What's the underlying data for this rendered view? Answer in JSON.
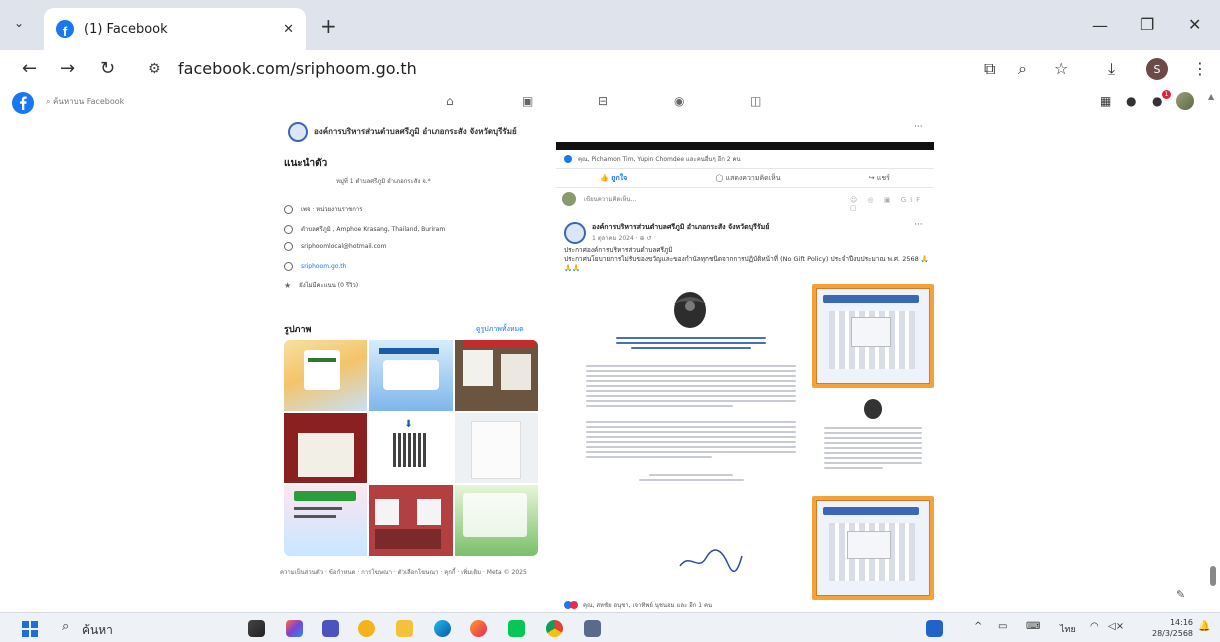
{
  "browser": {
    "tab_title": "(1) Facebook",
    "tab_close": "✕",
    "new_tab": "+",
    "url": "facebook.com/sriphoom.go.th",
    "profile_initial": "S",
    "window_minimize": "—",
    "window_restore": "❐",
    "window_close": "✕"
  },
  "fb": {
    "search_placeholder": "ค้นหาบน Facebook",
    "notification_count": "1"
  },
  "page": {
    "name": "องค์การบริหารส่วนตำบลศรีภูมิ อำเภอกระสัง จังหวัดบุรีรัมย์",
    "intro_title": "แนะนำตัว",
    "intro_desc": "หมู่ที่ 1 ตำบลศรีภูมิ อำเภอกระสัง จ.*",
    "info": [
      {
        "icon": "info-icon",
        "text": "เพจ · หน่วยงานราชการ"
      },
      {
        "icon": "location-icon",
        "text": "ตำบลศรีภูมิ , Amphoe Krasang, Thailand, Buriram"
      },
      {
        "icon": "email-icon",
        "text": "sriphoomlocal@hotmail.com"
      },
      {
        "icon": "globe-icon",
        "text": "sriphoom.go.th"
      },
      {
        "icon": "star-icon",
        "text": "ยังไม่มีคะแนน (0 รีวิว)"
      }
    ],
    "photos_title": "รูปภาพ",
    "photos_link": "ดูรูปภาพทั้งหมด",
    "footer": "ความเป็นส่วนตัว · ข้อกำหนด · การโฆษณา · ตัวเลือกโฆษณา · คุกกี้ · เพิ่มเติม · Meta © 2025"
  },
  "post": {
    "top_menu": "···",
    "reactions": "คุณ, Pichamon Tim, Yupin Chomdee และคนอื่นๆ อีก 2 คน",
    "like": "ถูกใจ",
    "comment": "แสดงความคิดเห็น",
    "share": "แชร์",
    "comment_placeholder": "เขียนความคิดเห็น...",
    "comment_tools": "☺ ◎ ▣ GIF ▢",
    "author": "องค์การบริหารส่วนตำบลศรีภูมิ อำเภอกระสัง จังหวัดบุรีรัมย์",
    "date": "1 ตุลาคม 2024 · ⊕ ↺",
    "more": "···",
    "text_line1": "ประกาศองค์การบริหารส่วนตำบลศรีภูมิ",
    "text_line2": "ประกาศนโยบายการไม่รับของขวัญและของกำนัลทุกชนิดจากการปฏิบัติหน้าที่ (No Gift Policy) ประจำปีงบประมาณ พ.ศ. 2568 🙏🙏🙏",
    "bottom_reactions": "คุณ, สหชัย อนุชา, เจาทิพย์ นุชนอม และ อีก 1 คน"
  },
  "taskbar": {
    "search": "ค้นหา",
    "lang": "ไทย",
    "time": "14:16",
    "date": "28/3/2568"
  }
}
